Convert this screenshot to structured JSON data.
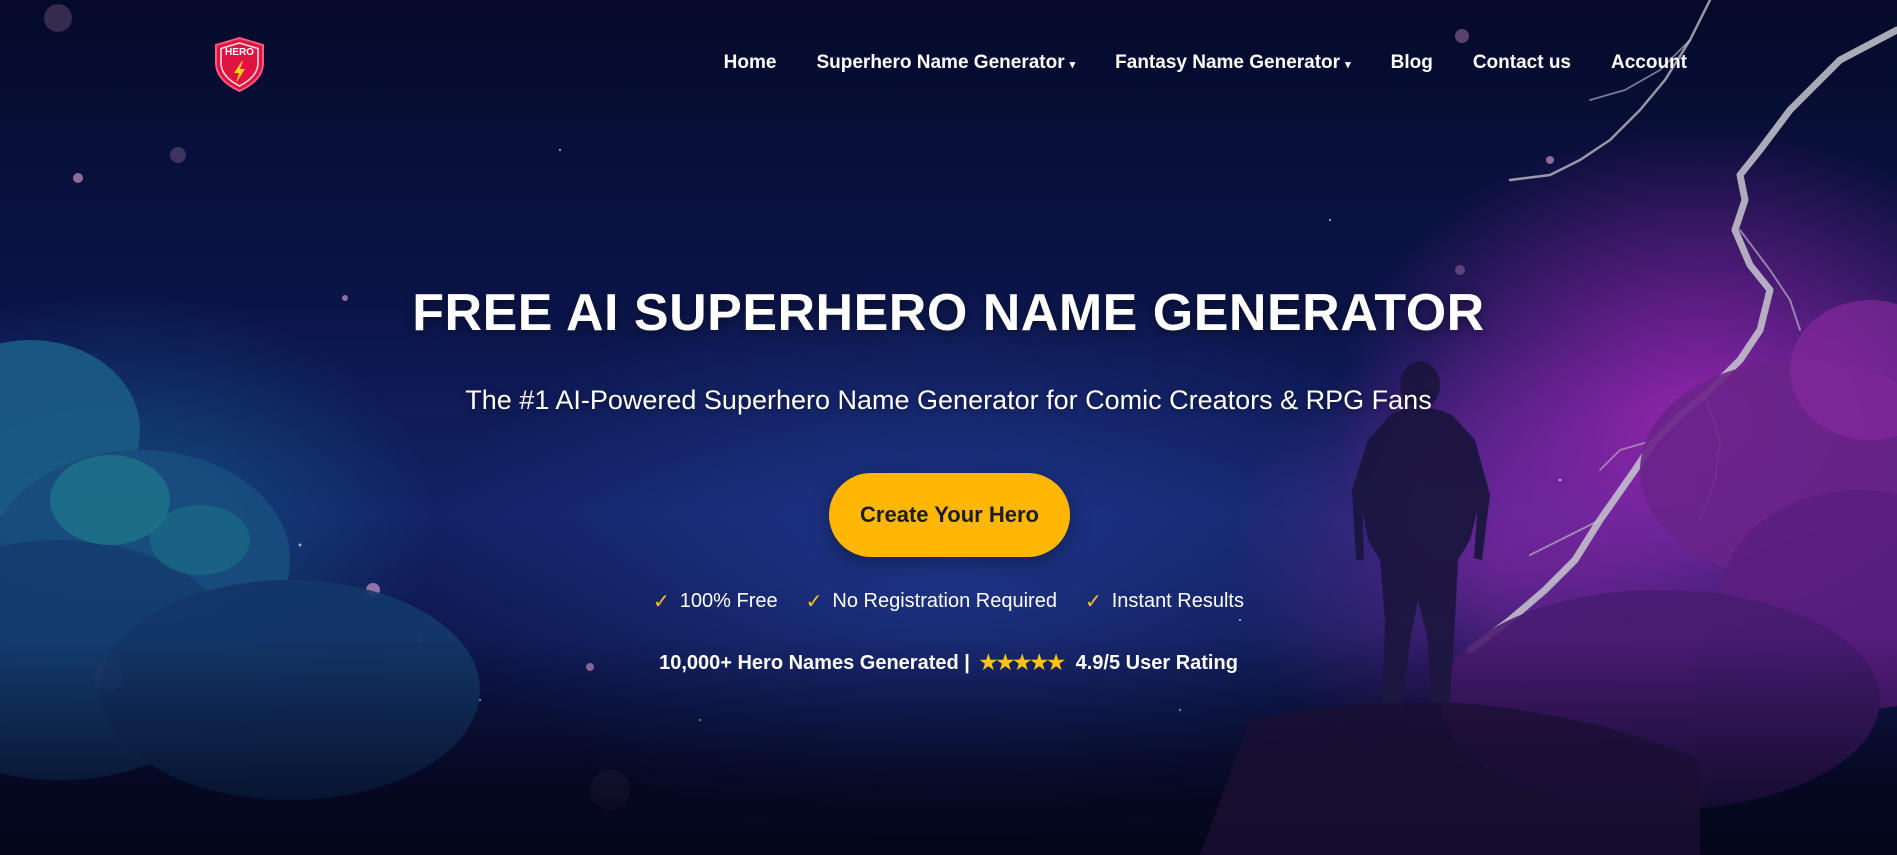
{
  "brand": {
    "logo_text": "HERO",
    "colors": {
      "shield": "#e0123f",
      "shield_border": "#ffffff",
      "bolt": "#ffd21a"
    }
  },
  "nav": {
    "items": [
      {
        "label": "Home",
        "has_dropdown": false
      },
      {
        "label": "Superhero Name Generator",
        "has_dropdown": true
      },
      {
        "label": "Fantasy Name Generator",
        "has_dropdown": true
      },
      {
        "label": "Blog",
        "has_dropdown": false
      },
      {
        "label": "Contact us",
        "has_dropdown": false
      },
      {
        "label": "Account",
        "has_dropdown": false
      }
    ],
    "dropdown_icon": "⌄"
  },
  "hero": {
    "title": "FREE AI SUPERHERO NAME GENERATOR",
    "subtitle": "The #1 AI-Powered Superhero Name Generator for Comic Creators & RPG Fans",
    "cta_label": "Create Your Hero",
    "features": [
      {
        "icon": "checkmark-icon",
        "glyph": "✓",
        "label": "100% Free"
      },
      {
        "icon": "checkmark-icon",
        "glyph": "✓",
        "label": "No Registration Required"
      },
      {
        "icon": "checkmark-icon",
        "glyph": "✓",
        "label": "Instant Results"
      }
    ],
    "stats": {
      "generated": "10,000+ Hero Names Generated |",
      "stars": "★★★★★",
      "rating": "4.9/5 User Rating"
    }
  },
  "colors": {
    "accent": "#ffb703",
    "check": "#ffc21a",
    "background_top": "#050a2a",
    "background_glow": "#be28c8"
  }
}
